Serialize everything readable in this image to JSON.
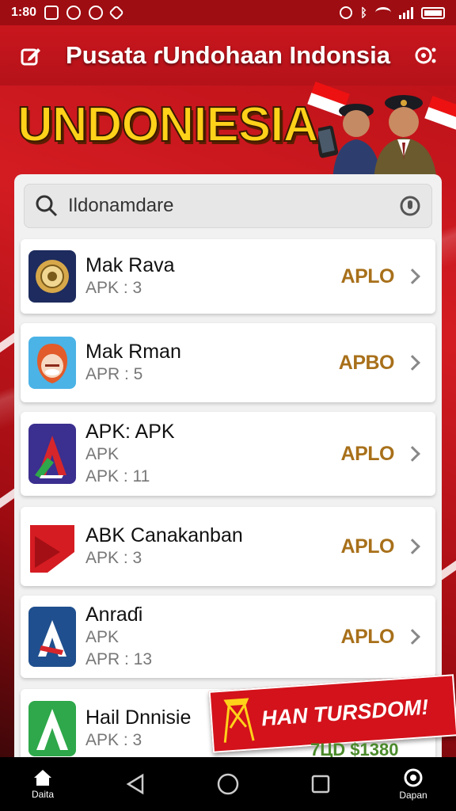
{
  "status_bar": {
    "time": "1:80",
    "right_text": "ᛒ"
  },
  "app_bar": {
    "title": "Pusata ɾUndohaan Indonsia",
    "left_icon": "edit-icon",
    "right_icon": "settings-search-icon"
  },
  "banner": {
    "headline": "UNDONIESIA"
  },
  "search": {
    "value": "Ildonamdare",
    "left_icon": "search-icon",
    "right_icon": "mic-icon"
  },
  "apps": [
    {
      "name": "Mak Rava",
      "lines": [
        "APK : 3"
      ],
      "action": "APLO",
      "icon": "emblem-icon",
      "colors": [
        "#1d2b5e",
        "#d7a84a"
      ]
    },
    {
      "name": "Mak Rman",
      "lines": [
        "APR : 5"
      ],
      "action": "APBO",
      "icon": "face-icon",
      "colors": [
        "#4bb3e6",
        "#e25b2a"
      ]
    },
    {
      "name": "APK: APK",
      "lines": [
        "APK",
        "APK : 11"
      ],
      "action": "APLO",
      "icon": "a-logo-icon",
      "colors": [
        "#3b2f8f",
        "#d6262b"
      ]
    },
    {
      "name": "ABK Canakanban",
      "lines": [
        "APK : 3"
      ],
      "action": "APLO",
      "icon": "red-arrow-icon",
      "colors": [
        "#d51c22",
        "#ffffff"
      ]
    },
    {
      "name": "Anraɗi",
      "lines": [
        "APK",
        "APR : 13"
      ],
      "action": "APLO",
      "icon": "blue-a-icon",
      "colors": [
        "#1f4f8e",
        "#ffffff"
      ]
    },
    {
      "name": "Hail Dnnisie",
      "lines": [
        "APK : 3"
      ],
      "action": "",
      "icon": "green-a-icon",
      "colors": [
        "#2ea84a",
        "#ffffff"
      ]
    }
  ],
  "promo": {
    "label": "HAN TURSDOM!",
    "price": "7ЦD $1380"
  },
  "nav_bar": {
    "left_label": "Daita",
    "right_label": "Dapan"
  }
}
